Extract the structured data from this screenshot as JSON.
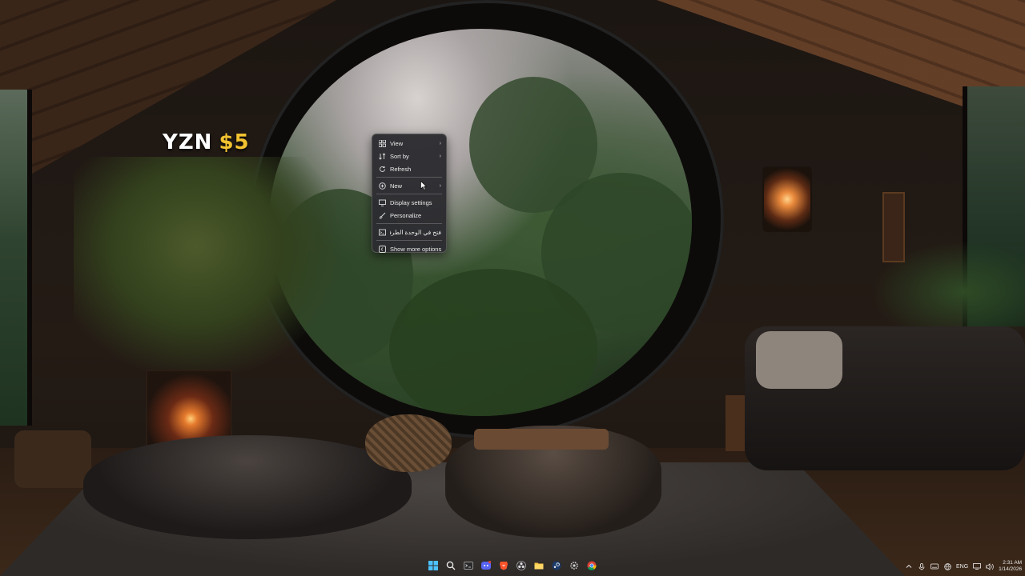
{
  "watermark": {
    "part1": "YZN",
    "part2": "$5"
  },
  "context_menu": {
    "items": [
      {
        "label": "View",
        "icon": "grid-icon",
        "submenu": true
      },
      {
        "label": "Sort by",
        "icon": "sort-icon",
        "submenu": true
      },
      {
        "label": "Refresh",
        "icon": "refresh-icon",
        "submenu": false
      },
      {
        "label": "New",
        "icon": "plus-circle-icon",
        "submenu": true
      },
      {
        "label": "Display settings",
        "icon": "display-icon",
        "submenu": false
      },
      {
        "label": "Personalize",
        "icon": "brush-icon",
        "submenu": false
      },
      {
        "label": "فتح في الوحدة الطرفية",
        "icon": "terminal-icon",
        "submenu": false
      },
      {
        "label": "Show more options",
        "icon": "more-options-icon",
        "submenu": false
      }
    ]
  },
  "taskbar": {
    "apps": [
      "windows-start-icon",
      "search-icon",
      "terminal-app-icon",
      "discord-icon",
      "brave-icon",
      "obs-icon",
      "file-explorer-icon",
      "steam-icon",
      "settings-app-icon",
      "chrome-icon"
    ],
    "tray": {
      "language": "ENG",
      "time": "2:31 AM",
      "date": "1/14/2026"
    }
  },
  "colors": {
    "menu_bg": "#2c2c30",
    "watermark_accent": "#f2c230",
    "watermark_main": "#ffffff"
  }
}
